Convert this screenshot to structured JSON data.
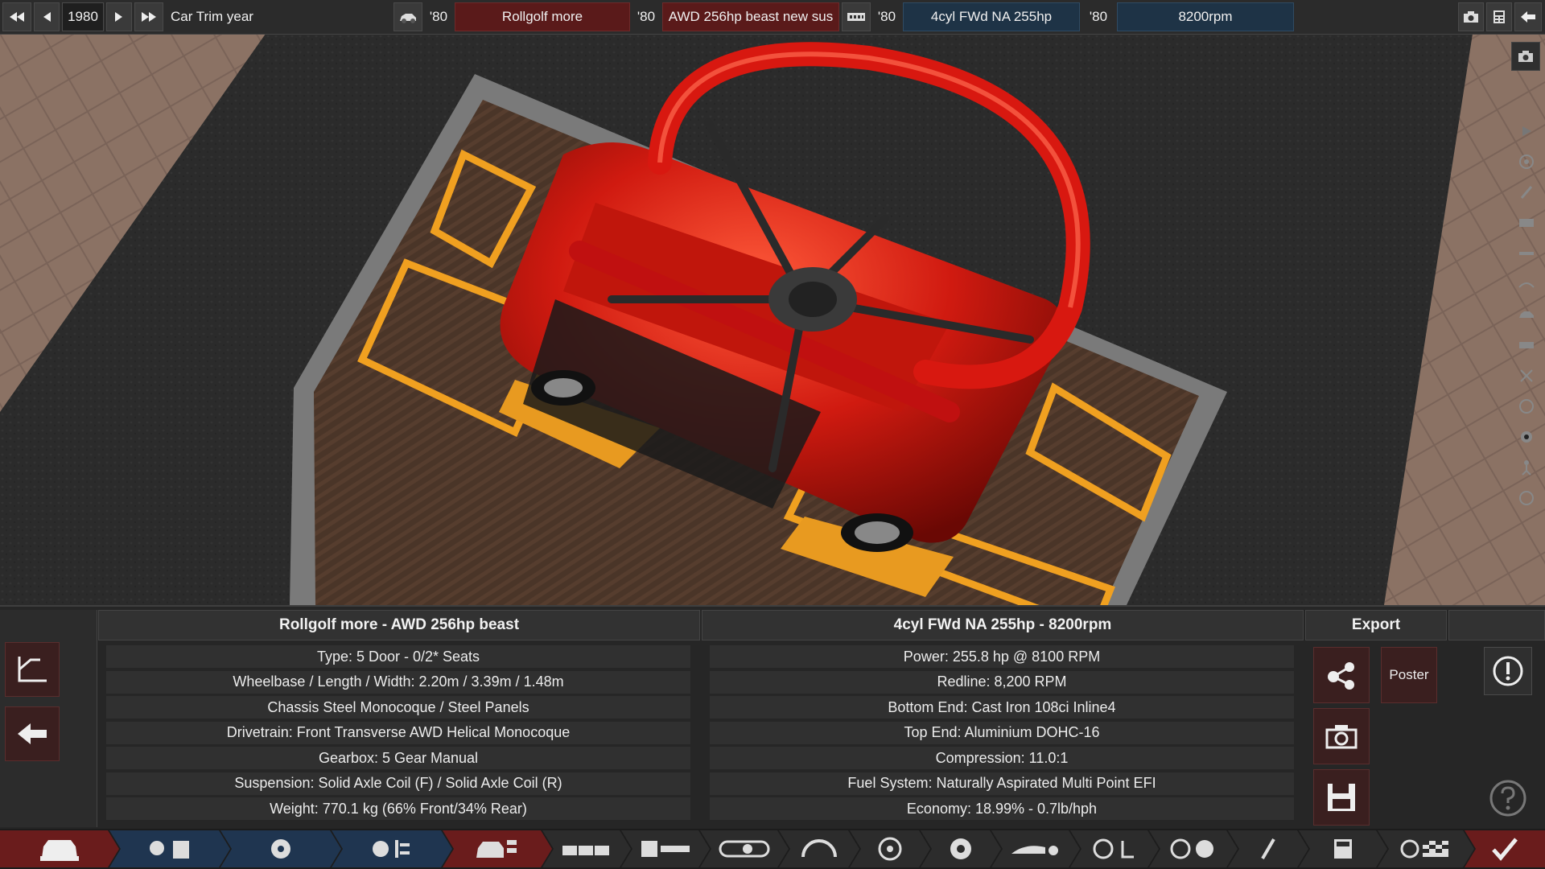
{
  "topbar": {
    "year": "1980",
    "year_label": "Car Trim year",
    "model_year": "'80",
    "model_name": "Rollgolf more",
    "trim_year": "'80",
    "trim_name": "AWD 256hp beast  new sus",
    "engine_family_year": "'80",
    "engine_family": "4cyl FWd NA 255hp",
    "variant_year": "'80",
    "variant_name": "8200rpm"
  },
  "car_panel": {
    "title": "Rollgolf more - AWD 256hp beast",
    "rows": [
      "Type: 5 Door - 0/2* Seats",
      "Wheelbase / Length / Width: 2.20m / 3.39m / 1.48m",
      "Chassis Steel Monocoque / Steel Panels",
      "Drivetrain: Front Transverse AWD Helical Monocoque",
      "Gearbox: 5 Gear Manual",
      "Suspension: Solid Axle Coil (F) / Solid Axle Coil (R)",
      "Weight: 770.1 kg (66% Front/34% Rear)"
    ]
  },
  "engine_panel": {
    "title": "4cyl FWd NA 255hp - 8200rpm",
    "rows": [
      "Power: 255.8 hp @ 8100 RPM",
      "Redline:  8,200 RPM",
      "Bottom End: Cast Iron 108ci Inline4",
      "Top End: Aluminium DOHC-16",
      "Compression: 11.0:1",
      "Fuel System: Naturally Aspirated Multi Point EFI",
      "Economy: 18.99% - 0.7lb/hph"
    ]
  },
  "export": {
    "title": "Export",
    "poster_label": "Poster"
  },
  "colors": {
    "accent_red": "#5a1a1a",
    "accent_blue": "#1e3346",
    "car_red": "#d01a10",
    "floor_orange": "#f0a020"
  },
  "icons": {
    "sidebar": [
      "play-icon",
      "wheel-icon",
      "brush-icon",
      "engine-icon",
      "body-icon",
      "fixture-icon",
      "car-icon",
      "gearbox-icon",
      "suspension-icon",
      "tire-icon",
      "settings-icon",
      "driver-icon",
      "circle-icon"
    ]
  }
}
